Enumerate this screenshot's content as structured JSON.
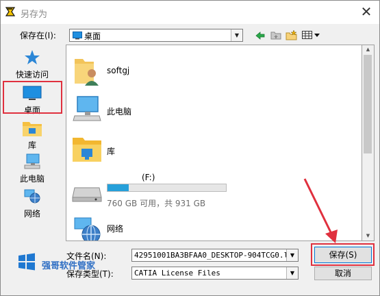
{
  "window": {
    "title": "另存为",
    "close": "✕"
  },
  "toolbar": {
    "save_in_label": "保存在(I):",
    "location_value": "桌面",
    "back_icon": "arrow-left-icon",
    "up_icon": "up-folder-icon",
    "new_folder_icon": "new-folder-icon",
    "view_icon": "view-menu-icon"
  },
  "places": [
    {
      "label": "快速访问",
      "icon": "star-icon"
    },
    {
      "label": "桌面",
      "icon": "desktop-icon",
      "selected": true
    },
    {
      "label": "库",
      "icon": "library-folder-icon"
    },
    {
      "label": "此电脑",
      "icon": "computer-icon"
    },
    {
      "label": "网络",
      "icon": "network-icon"
    }
  ],
  "items": [
    {
      "name": "softgj",
      "icon": "user-folder-icon"
    },
    {
      "name": "此电脑",
      "icon": "computer-icon"
    },
    {
      "name": "库",
      "icon": "library-folder-icon"
    },
    {
      "name": "(F:)",
      "icon": "drive-icon",
      "usage_text": "760 GB 可用，共 931 GB",
      "used_fraction": 0.18
    },
    {
      "name": "网络",
      "icon": "network-icon"
    }
  ],
  "form": {
    "filename_label": "文件名(N):",
    "filename_value": "42951001BA3BFAA0_DESKTOP-904TCG0.lic",
    "filetype_label": "保存类型(T):",
    "filetype_value": "CATIA License Files",
    "save_button": "保存(S)",
    "cancel_button": "取消"
  },
  "watermark": {
    "text": "强哥软件管家"
  },
  "colors": {
    "highlight_box": "#e0303e",
    "drive_bar": "#26a0da",
    "watermark": "#2f6fc4"
  }
}
